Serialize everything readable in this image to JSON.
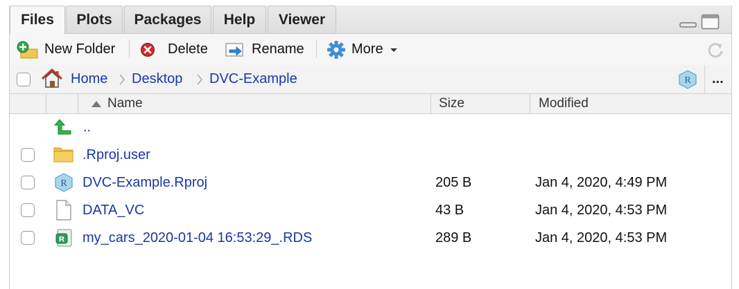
{
  "tabs": [
    {
      "label": "Files",
      "active": true
    },
    {
      "label": "Plots",
      "active": false
    },
    {
      "label": "Packages",
      "active": false
    },
    {
      "label": "Help",
      "active": false
    },
    {
      "label": "Viewer",
      "active": false
    }
  ],
  "toolbar": {
    "new_folder": "New Folder",
    "delete": "Delete",
    "rename": "Rename",
    "more": "More"
  },
  "breadcrumb": {
    "items": [
      "Home",
      "Desktop",
      "DVC-Example"
    ],
    "more_label": "..."
  },
  "columns": {
    "name": "Name",
    "size": "Size",
    "modified": "Modified",
    "sort": "ascending"
  },
  "files": [
    {
      "name": "..",
      "size": "",
      "modified": "",
      "icon": "parent-dir-icon"
    },
    {
      "name": ".Rproj.user",
      "size": "",
      "modified": "",
      "icon": "folder-icon"
    },
    {
      "name": "DVC-Example.Rproj",
      "size": "205 B",
      "modified": "Jan 4, 2020, 4:49 PM",
      "icon": "rproj-icon"
    },
    {
      "name": "DATA_VC",
      "size": "43 B",
      "modified": "Jan 4, 2020, 4:53 PM",
      "icon": "file-icon"
    },
    {
      "name": "my_cars_2020-01-04 16:53:29_.RDS",
      "size": "289 B",
      "modified": "Jan 4, 2020, 4:53 PM",
      "icon": "rds-icon"
    }
  ],
  "colors": {
    "link": "#1a37a6",
    "tab_bg": "#e2e2e2",
    "toolbar_bg": "#f6f6f6"
  }
}
